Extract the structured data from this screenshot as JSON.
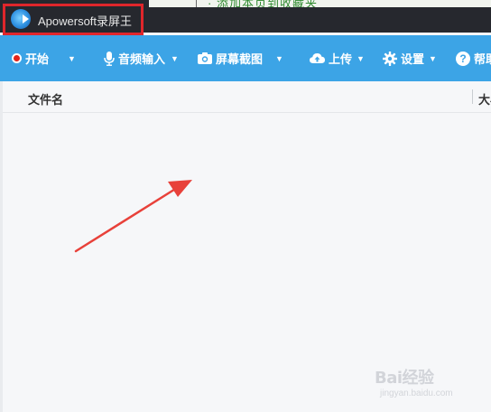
{
  "window": {
    "title": "Apowersoft录屏王",
    "background_text": "· 添加本页到收藏夹"
  },
  "toolbar": {
    "items": [
      {
        "label": "开始",
        "icon": "record-icon"
      },
      {
        "label": "音频输入",
        "icon": "microphone-icon"
      },
      {
        "label": "屏幕截图",
        "icon": "camera-icon"
      },
      {
        "label": "上传",
        "icon": "cloud-upload-icon"
      },
      {
        "label": "设置",
        "icon": "gear-icon"
      },
      {
        "label": "帮助",
        "icon": "help-icon",
        "glyph": "?"
      }
    ],
    "caret": "▼"
  },
  "table": {
    "columns": [
      "文件名",
      "大小"
    ],
    "rows": []
  },
  "watermark": {
    "brand": "Bai经验",
    "url": "jingyan.baidu.com"
  },
  "colors": {
    "titlebar": "#26282e",
    "toolbar": "#3ca4e6",
    "highlight": "#e0262b",
    "arrow": "#e8413a"
  }
}
